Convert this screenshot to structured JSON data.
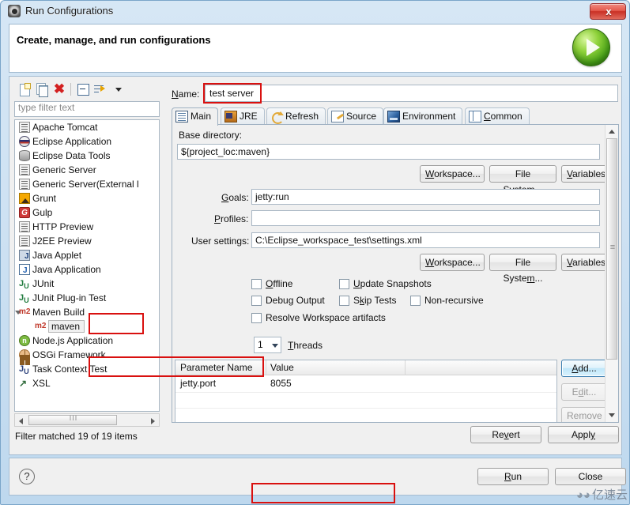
{
  "window": {
    "title": "Run Configurations",
    "close_label": "x",
    "icon": "gear-icon"
  },
  "header": {
    "title": "Create, manage, and run configurations",
    "icon": "run-green-play-icon"
  },
  "tree_toolbar": {
    "items": [
      {
        "name": "new-launch-configuration-icon",
        "label": "New"
      },
      {
        "name": "duplicate-icon",
        "label": "Duplicate"
      },
      {
        "name": "delete-icon",
        "label": "Delete"
      },
      {
        "name": "collapse-all-icon",
        "label": "Collapse All"
      },
      {
        "name": "filter-icon",
        "label": "Filter"
      },
      {
        "name": "chevron-down-icon",
        "label": "Menu"
      }
    ]
  },
  "filter": {
    "placeholder": "type filter text",
    "value": "",
    "status": "Filter matched 19 of 19 items"
  },
  "tree": {
    "items": [
      {
        "label": "Apache Tomcat",
        "icon": "server-icon",
        "depth": 0,
        "selected": false
      },
      {
        "label": "Eclipse Application",
        "icon": "eclipse-icon",
        "depth": 0,
        "selected": false
      },
      {
        "label": "Eclipse Data Tools",
        "icon": "database-icon",
        "depth": 0,
        "selected": false
      },
      {
        "label": "Generic Server",
        "icon": "server-icon",
        "depth": 0,
        "selected": false
      },
      {
        "label": "Generic Server(External l",
        "icon": "server-icon",
        "depth": 0,
        "selected": false
      },
      {
        "label": "Grunt",
        "icon": "grunt-icon",
        "depth": 0,
        "selected": false
      },
      {
        "label": "Gulp",
        "icon": "gulp-icon",
        "depth": 0,
        "selected": false
      },
      {
        "label": "HTTP Preview",
        "icon": "server-icon",
        "depth": 0,
        "selected": false
      },
      {
        "label": "J2EE Preview",
        "icon": "server-icon",
        "depth": 0,
        "selected": false
      },
      {
        "label": "Java Applet",
        "icon": "java-applet-icon",
        "depth": 0,
        "selected": false
      },
      {
        "label": "Java Application",
        "icon": "java-application-icon",
        "depth": 0,
        "selected": false
      },
      {
        "label": "JUnit",
        "icon": "junit-icon",
        "depth": 0,
        "selected": false
      },
      {
        "label": "JUnit Plug-in Test",
        "icon": "junit-plugin-icon",
        "depth": 0,
        "selected": false
      },
      {
        "label": "Maven Build",
        "icon": "maven-icon",
        "depth": 0,
        "selected": false,
        "expanded": true
      },
      {
        "label": "maven",
        "icon": "maven-icon",
        "depth": 1,
        "selected": true
      },
      {
        "label": "Node.js Application",
        "icon": "nodejs-icon",
        "depth": 0,
        "selected": false
      },
      {
        "label": "OSGi Framework",
        "icon": "osgi-icon",
        "depth": 0,
        "selected": false
      },
      {
        "label": "Task Context Test",
        "icon": "task-context-icon",
        "depth": 0,
        "selected": false
      },
      {
        "label": "XSL",
        "icon": "xsl-icon",
        "depth": 0,
        "selected": false
      }
    ]
  },
  "name_field": {
    "label": "Name:",
    "value": "test server",
    "highlighted": true
  },
  "tabs": [
    {
      "label": "Main",
      "icon": "main-tab-icon",
      "active": true
    },
    {
      "label": "JRE",
      "icon": "jre-tab-icon",
      "active": false
    },
    {
      "label": "Refresh",
      "icon": "refresh-tab-icon",
      "active": false
    },
    {
      "label": "Source",
      "icon": "source-tab-icon",
      "active": false
    },
    {
      "label": "Environment",
      "icon": "environment-tab-icon",
      "active": false
    },
    {
      "label": "Common",
      "icon": "common-tab-icon",
      "active": false
    }
  ],
  "main_tab": {
    "base_directory": {
      "label": "Base directory:",
      "value": "${project_loc:maven}"
    },
    "base_dir_buttons": [
      {
        "label": "Workspace...",
        "name": "base-workspace-button"
      },
      {
        "label": "File System...",
        "name": "base-filesystem-button"
      },
      {
        "label": "Variables...",
        "name": "base-variables-button"
      }
    ],
    "goals": {
      "label": "Goals:",
      "value": "jetty:run",
      "highlighted": true
    },
    "profiles": {
      "label": "Profiles:",
      "value": ""
    },
    "user_settings": {
      "label": "User settings:",
      "value": "C:\\Eclipse_workspace_test\\settings.xml",
      "highlighted": true
    },
    "user_settings_buttons": [
      {
        "label": "Workspace...",
        "name": "settings-workspace-button"
      },
      {
        "label": "File System...",
        "name": "settings-filesystem-button"
      },
      {
        "label": "Variables...",
        "name": "settings-variables-button"
      }
    ],
    "checkboxes": [
      {
        "label": "Offline",
        "checked": false,
        "name": "offline-checkbox"
      },
      {
        "label": "Update Snapshots",
        "checked": false,
        "name": "update-snapshots-checkbox"
      },
      {
        "label": "Debug Output",
        "checked": false,
        "name": "debug-output-checkbox"
      },
      {
        "label": "Skip Tests",
        "checked": false,
        "name": "skip-tests-checkbox"
      },
      {
        "label": "Non-recursive",
        "checked": false,
        "name": "non-recursive-checkbox"
      },
      {
        "label": "Resolve Workspace artifacts",
        "checked": false,
        "name": "resolve-workspace-artifacts-checkbox"
      }
    ],
    "threads": {
      "value": "1",
      "label": "Threads"
    },
    "parameter_table": {
      "columns": [
        "Parameter Name",
        "Value"
      ],
      "rows": [
        {
          "name": "jetty.port",
          "value": "8055",
          "highlighted": true
        }
      ]
    },
    "table_buttons": [
      {
        "label": "Add...",
        "name": "add-parameter-button",
        "state": "focus"
      },
      {
        "label": "Edit...",
        "name": "edit-parameter-button",
        "state": "disabled"
      },
      {
        "label": "Remove",
        "name": "remove-parameter-button",
        "state": "disabled"
      }
    ]
  },
  "config_actions": [
    {
      "label": "Revert",
      "name": "revert-button"
    },
    {
      "label": "Apply",
      "name": "apply-button"
    }
  ],
  "footer": {
    "help_label": "?",
    "buttons": [
      {
        "label": "Run",
        "name": "run-button"
      },
      {
        "label": "Close",
        "name": "close-dialog-button"
      }
    ],
    "watermark": "亿速云"
  },
  "colors": {
    "annotation": "#d9100f",
    "titlebar": "#cfe2f3",
    "run_green": "#46a016",
    "close_red": "#c93024"
  }
}
